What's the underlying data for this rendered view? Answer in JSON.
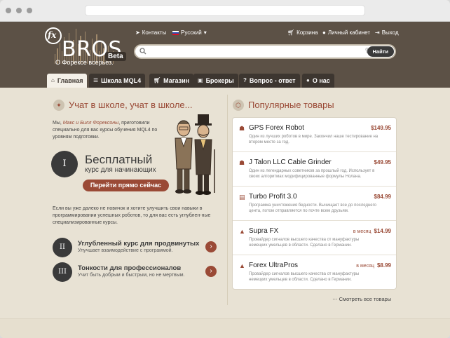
{
  "header": {
    "logo_fx": "fx",
    "logo_text": "BROS",
    "beta": "Beta",
    "tagline": "О Форексе всерьез.",
    "links": {
      "contacts": "Контакты",
      "language": "Русский",
      "cart": "Корзина",
      "account": "Личный кабинет",
      "logout": "Выход"
    },
    "search": {
      "placeholder": "",
      "button": "Найти"
    }
  },
  "nav": {
    "tabs": [
      {
        "label": "Главная",
        "icon": "home-icon",
        "active": true
      },
      {
        "label": "Школа MQL4",
        "icon": "list-icon"
      },
      {
        "label": "Магазин",
        "icon": "cart-icon"
      },
      {
        "label": "Брокеры",
        "icon": "briefcase-icon"
      },
      {
        "label": "Вопрос - ответ",
        "icon": "question-icon"
      },
      {
        "label": "О нас",
        "icon": "user-icon"
      }
    ]
  },
  "school": {
    "title": "Учат в школе, учат в школе...",
    "intro_prefix": "Мы, ",
    "intro_names": "Макс и Билл Форексоны",
    "intro_suffix": ", приготовили специально для вас курсы обучения MQL4 по уровням подготовки.",
    "free_number": "I",
    "free_title": "Бесплатный",
    "free_sub": "курс для начинающих",
    "free_button": "Перейти прямо сейчас",
    "para2": "Если вы уже далеко не новичок и хотите улучшить свои навыки в программировании успешных роботов, то для вас есть углублен-ные специализированные курсы.",
    "courses": [
      {
        "num": "II",
        "title": "Углубленный курс для продвинутых",
        "sub": "Улучшает взаимодействие с программой."
      },
      {
        "num": "III",
        "title": "Тонкости для профессионалов",
        "sub": "Учит быть добрым и быстрым, но не мертвым."
      }
    ]
  },
  "products": {
    "title": "Популярные товары",
    "see_all": "Смотреть все товары",
    "items": [
      {
        "name": "GPS Forex Robot",
        "price": "$149.95",
        "per": "",
        "icon": "robot-icon",
        "desc": "Один из лучших роботов в мире. Закончил наше тестирование на втором месте за год."
      },
      {
        "name": "J Talon LLC Cable Grinder",
        "price": "$49.95",
        "per": "",
        "icon": "robot-icon",
        "desc": "Один из легендарных советников за прошлый год. Использует в своих алгоритмах модифицированные формулы Нолана."
      },
      {
        "name": "Turbo Profit 3.0",
        "price": "$84.99",
        "per": "",
        "icon": "calendar-icon",
        "desc": "Программа уничтожения бедности. Вычищает все до последнего цента, потом отправляется по почте всем друзьям."
      },
      {
        "name": "Supra FX",
        "price": "$14.99",
        "per": "в месяц",
        "icon": "warning-icon",
        "desc": "Провайдер сигналов высшего качества от мануфактуры немецких умельцев в области. Сделано в Германии."
      },
      {
        "name": "Forex UltraPros",
        "price": "$8.99",
        "per": "в месяц",
        "icon": "warning-icon",
        "desc": "Провайдер сигналов высшего качества от мануфактуры немецких умельцев в области. Сделано в Германии."
      }
    ]
  }
}
